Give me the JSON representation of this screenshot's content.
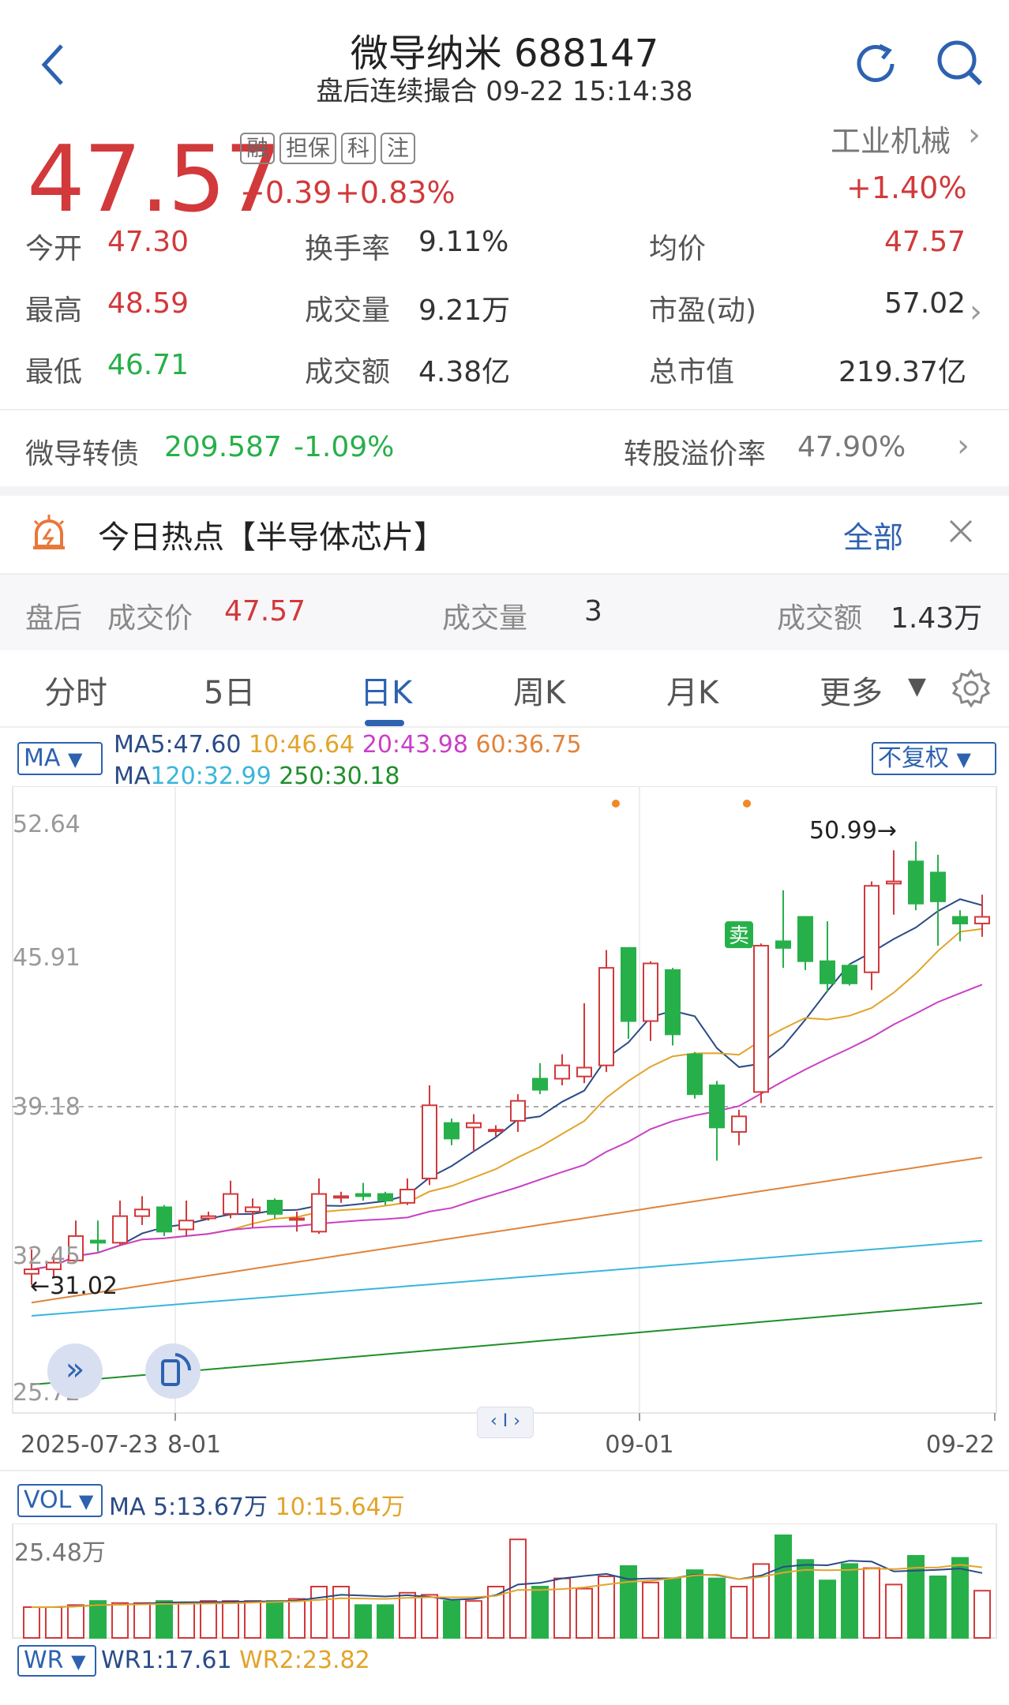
{
  "header": {
    "title": "微导纳米 688147",
    "subtitle": "盘后连续撮合 09-22 15:14:38"
  },
  "quote": {
    "price": "47.57",
    "change": "+0.39",
    "change_pct": "+0.83%",
    "badges": [
      "融",
      "担保",
      "科",
      "注"
    ],
    "industry": "工业机械",
    "industry_pct": "+1.40%"
  },
  "stats": [
    {
      "label": "今开",
      "value": "47.30",
      "color": "#d2393b"
    },
    {
      "label": "最高",
      "value": "48.59",
      "color": "#d2393b"
    },
    {
      "label": "最低",
      "value": "46.71",
      "color": "#27b04a"
    },
    {
      "label": "换手率",
      "value": "9.11%",
      "color": "#333"
    },
    {
      "label": "成交量",
      "value": "9.21万",
      "color": "#333"
    },
    {
      "label": "成交额",
      "value": "4.38亿",
      "color": "#333"
    },
    {
      "label": "均价",
      "value": "47.57",
      "color": "#d2393b"
    },
    {
      "label": "市盈(动)",
      "value": "57.02",
      "color": "#333"
    },
    {
      "label": "总市值",
      "value": "219.37亿",
      "color": "#333"
    }
  ],
  "bond": {
    "label": "微导转债",
    "price": "209.587",
    "pct": "-1.09%",
    "premium_label": "转股溢价率",
    "premium": "47.90%"
  },
  "hot": {
    "text": "今日热点【半导体芯片】",
    "all": "全部"
  },
  "afterhours": {
    "title": "盘后",
    "price_label": "成交价",
    "price": "47.57",
    "vol_label": "成交量",
    "vol": "3",
    "amt_label": "成交额",
    "amt": "1.43万"
  },
  "tabs": [
    "分时",
    "5日",
    "日K",
    "周K",
    "月K",
    "更多"
  ],
  "active_tab": "日K",
  "ma": {
    "selector": "MA",
    "l1a": "MA5:47.60",
    "l1b": "10:46.64",
    "l1c": "20:43.98",
    "l1d": "60:36.75",
    "l2a": "MA",
    "l2b": "120:32.99",
    "l2c": "250:30.18",
    "adjust": "不复权"
  },
  "chart_data": {
    "type": "candlestick",
    "y_ticks": [
      "52.64",
      "45.91",
      "39.18",
      "32.45",
      "25.72"
    ],
    "ylim": [
      25.72,
      52.64
    ],
    "x_labels": [
      "2025-07-23",
      "8-01",
      "09-01",
      "09-22"
    ],
    "annotations": {
      "high": "50.99→",
      "low": "←31.02",
      "sell": "卖"
    },
    "candles": [
      [
        31.5,
        32.6,
        31.0,
        31.7
      ],
      [
        31.7,
        32.4,
        31.3,
        32.0
      ],
      [
        32.1,
        33.9,
        32.0,
        33.2
      ],
      [
        33.0,
        33.9,
        32.5,
        32.9
      ],
      [
        32.9,
        34.8,
        32.8,
        34.1
      ],
      [
        34.1,
        35.0,
        33.7,
        34.4
      ],
      [
        34.5,
        34.6,
        33.2,
        33.4
      ],
      [
        33.5,
        34.8,
        33.2,
        33.9
      ],
      [
        34.0,
        34.3,
        33.9,
        34.1
      ],
      [
        34.2,
        35.7,
        34.0,
        35.1
      ],
      [
        34.3,
        34.9,
        33.6,
        34.5
      ],
      [
        34.8,
        34.9,
        34.0,
        34.2
      ],
      [
        34.0,
        34.3,
        33.4,
        34.0
      ],
      [
        33.4,
        35.8,
        33.3,
        35.1
      ],
      [
        35.0,
        35.2,
        34.7,
        35.0
      ],
      [
        35.1,
        35.6,
        34.8,
        35.0
      ],
      [
        35.1,
        35.2,
        34.6,
        34.8
      ],
      [
        34.7,
        35.8,
        34.6,
        35.3
      ],
      [
        35.8,
        40.0,
        35.5,
        39.1
      ],
      [
        38.3,
        38.5,
        37.3,
        37.6
      ],
      [
        38.1,
        38.7,
        37.0,
        38.3
      ],
      [
        38.0,
        38.2,
        37.7,
        38.0
      ],
      [
        38.4,
        39.6,
        37.9,
        39.3
      ],
      [
        40.3,
        41.0,
        39.6,
        39.8
      ],
      [
        40.3,
        41.4,
        40.0,
        40.9
      ],
      [
        40.4,
        43.7,
        40.1,
        40.8
      ],
      [
        40.9,
        46.1,
        40.6,
        45.3
      ],
      [
        46.2,
        46.2,
        42.1,
        42.9
      ],
      [
        42.9,
        45.6,
        42.0,
        45.5
      ],
      [
        45.2,
        45.3,
        41.8,
        42.3
      ],
      [
        41.4,
        41.5,
        39.4,
        39.6
      ],
      [
        40.0,
        40.2,
        36.6,
        38.1
      ],
      [
        37.9,
        38.9,
        37.3,
        38.6
      ],
      [
        39.7,
        46.4,
        39.2,
        46.3
      ],
      [
        46.5,
        48.8,
        45.3,
        46.2
      ],
      [
        47.6,
        47.6,
        45.2,
        45.6
      ],
      [
        45.6,
        47.4,
        44.2,
        44.6
      ],
      [
        45.4,
        45.5,
        44.5,
        44.6
      ],
      [
        45.1,
        49.2,
        44.3,
        49.0
      ],
      [
        49.1,
        50.6,
        47.7,
        49.2
      ],
      [
        50.1,
        51.0,
        47.9,
        48.2
      ],
      [
        49.6,
        50.4,
        46.3,
        48.3
      ],
      [
        47.6,
        47.9,
        46.5,
        47.3
      ],
      [
        47.3,
        48.6,
        46.7,
        47.6
      ]
    ],
    "ma_labels": [
      "MA5",
      "MA10",
      "MA20",
      "MA60",
      "MA120",
      "MA250"
    ]
  },
  "vol": {
    "selector": "VOL",
    "a": "MA 5:13.67万",
    "b": "10:15.64万",
    "top": "25.48万"
  },
  "wr": {
    "selector": "WR",
    "a": "WR1:17.61",
    "b": "WR2:23.82"
  }
}
